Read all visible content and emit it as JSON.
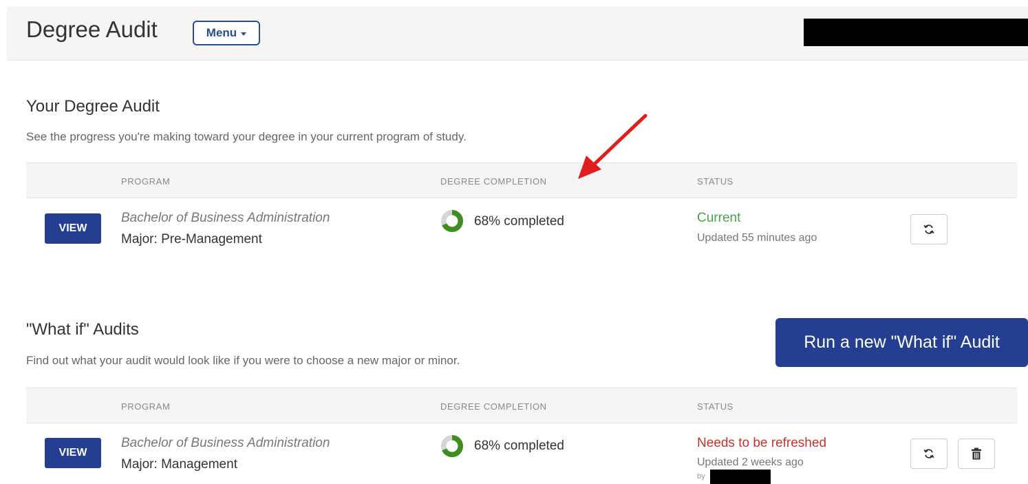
{
  "header": {
    "title": "Degree Audit",
    "menu_label": "Menu"
  },
  "current": {
    "title": "Your Degree Audit",
    "description": "See the progress you're making toward your degree in your current program of study.",
    "columns": {
      "program": "PROGRAM",
      "completion": "DEGREE COMPLETION",
      "status": "STATUS"
    },
    "row": {
      "view_label": "VIEW",
      "program": "Bachelor of Business Administration",
      "major": "Major: Pre-Management",
      "completion_pct": 68,
      "completion_text": "68% completed",
      "status": "Current",
      "updated": "Updated 55 minutes ago"
    }
  },
  "whatif": {
    "title": "\"What if\" Audits",
    "description": "Find out what your audit would look like if you were to choose a new major or minor.",
    "run_label": "Run a new \"What if\" Audit",
    "columns": {
      "program": "PROGRAM",
      "completion": "DEGREE COMPLETION",
      "status": "STATUS"
    },
    "row": {
      "view_label": "VIEW",
      "program": "Bachelor of Business Administration",
      "major": "Major: Management",
      "completion_pct": 68,
      "completion_text": "68% completed",
      "status": "Needs to be refreshed",
      "updated": "Updated 2 weeks ago",
      "by": "by"
    }
  },
  "colors": {
    "primary": "#243f91",
    "status_current": "#4aa34a",
    "status_refresh": "#c9302c",
    "donut_fill": "#3f8f1f",
    "donut_track": "#d6d6d6",
    "annotation_arrow": "#e01e1e"
  },
  "icons": [
    "refresh-icon",
    "trash-icon",
    "chevron-down-icon",
    "annotation-arrow-icon"
  ]
}
